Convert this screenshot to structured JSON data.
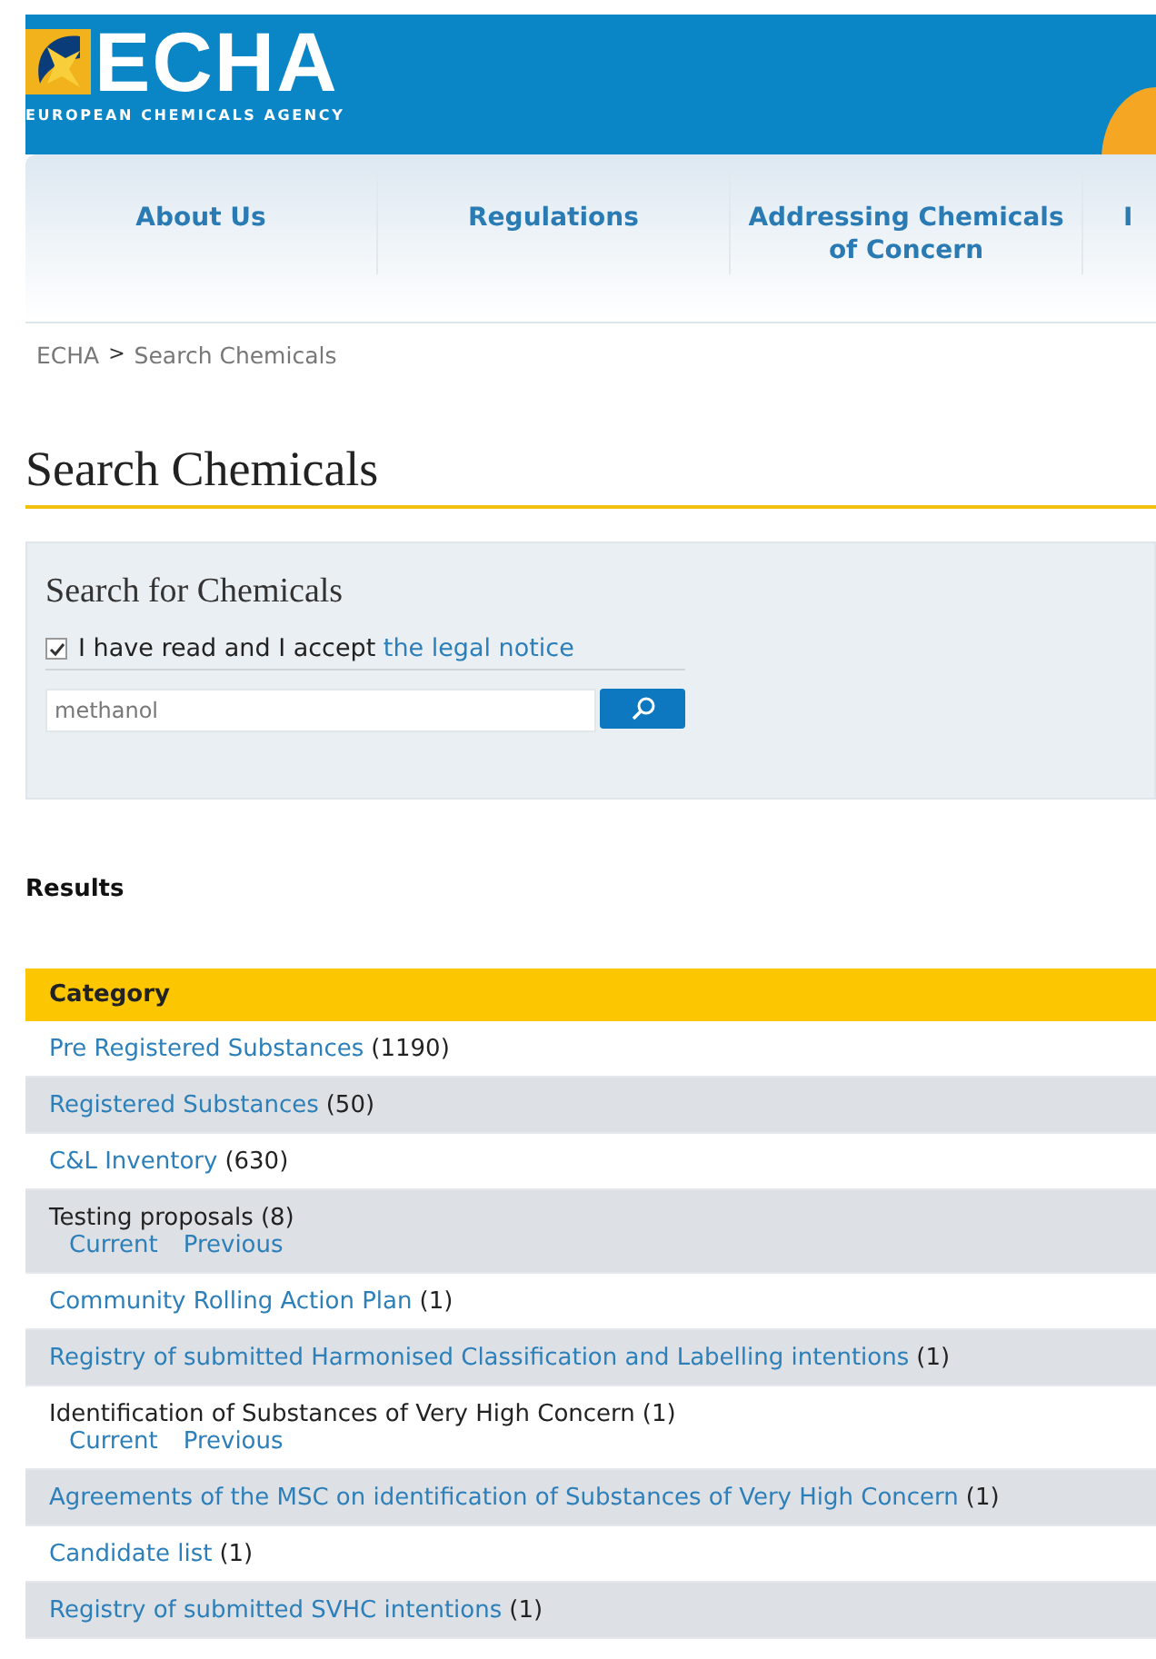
{
  "header": {
    "logo_text": "ECHA",
    "logo_subtitle": "EUROPEAN CHEMICALS AGENCY"
  },
  "nav": [
    {
      "label": "About Us"
    },
    {
      "label": "Regulations"
    },
    {
      "label": "Addressing Chemicals of Concern"
    },
    {
      "label": "I"
    }
  ],
  "breadcrumb": {
    "items": [
      "ECHA",
      "Search Chemicals"
    ],
    "separator": ">"
  },
  "page_title": "Search Chemicals",
  "search_panel": {
    "title": "Search for Chemicals",
    "accept": {
      "checked": true,
      "label": "I have read and I accept ",
      "link": "the legal notice"
    },
    "query": "methanol"
  },
  "results": {
    "title": "Results",
    "column": "Category",
    "rows": [
      {
        "name": "Pre Registered Substances",
        "linked": true,
        "count": "(1190)"
      },
      {
        "name": "Registered Substances",
        "linked": true,
        "count": "(50)"
      },
      {
        "name": "C&L Inventory",
        "linked": true,
        "count": "(630)"
      },
      {
        "name": "Testing proposals",
        "linked": false,
        "count": "(8)",
        "sublinks": [
          "Current",
          "Previous"
        ]
      },
      {
        "name": "Community Rolling Action Plan",
        "linked": true,
        "count": "(1)"
      },
      {
        "name": "Registry of submitted Harmonised Classification and Labelling intentions",
        "linked": true,
        "count": "(1)"
      },
      {
        "name": "Identification of Substances of Very High Concern",
        "linked": false,
        "count": "(1)",
        "sublinks": [
          "Current",
          "Previous"
        ]
      },
      {
        "name": "Agreements of the MSC on identification of Substances of Very High Concern",
        "linked": true,
        "count": "(1)"
      },
      {
        "name": "Candidate list",
        "linked": true,
        "count": "(1)"
      },
      {
        "name": "Registry of submitted SVHC intentions",
        "linked": true,
        "count": "(1)"
      }
    ]
  }
}
